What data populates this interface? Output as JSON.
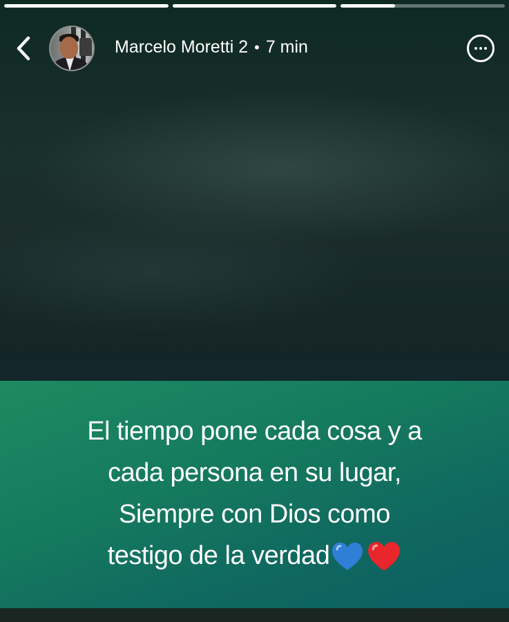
{
  "story": {
    "progress": [
      1.0,
      1.0,
      0.33
    ],
    "author": {
      "name": "Marcelo Moretti 2",
      "separator": "•",
      "time": "7 min"
    },
    "caption": {
      "lines": [
        "El tiempo pone cada cosa y a",
        "cada persona en su lugar,",
        "Siempre con Dios como",
        "testigo de la verdad"
      ]
    },
    "icons": {
      "back": "chevron-left-icon",
      "more": "more-options-icon",
      "heart_blue": "blue-heart-icon",
      "heart_red": "red-heart-icon"
    },
    "colors": {
      "caption_bg": "#15805f",
      "heart_blue": "#2f7fd6",
      "heart_red": "#e8262c",
      "text": "#ffffff"
    }
  }
}
